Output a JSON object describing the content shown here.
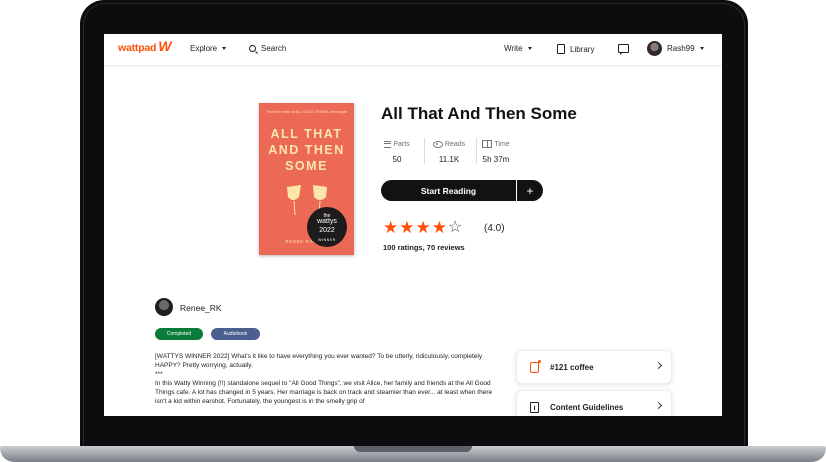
{
  "nav": {
    "logo_text": "wattpad",
    "logo_mark": "W",
    "explore_label": "Explore",
    "search_label": "Search",
    "write_label": "Write",
    "library_label": "Library",
    "username": "Rash99"
  },
  "book": {
    "title": "All That And Then Some",
    "cover": {
      "tagline": "From the writer of ALL GOOD THINGS, the sequel ...",
      "title_lines": [
        "ALL THAT",
        "AND THEN",
        "SOME"
      ],
      "author_line": "RENEE RACHEL",
      "badge": {
        "the": "the",
        "name": "wattys",
        "year": "2022",
        "label": "WINNER"
      },
      "background": "#ec6a55"
    },
    "stats": [
      {
        "label": "Parts",
        "value": "50",
        "icon": "list-icon"
      },
      {
        "label": "Reads",
        "value": "11.1K",
        "icon": "eye-icon"
      },
      {
        "label": "Time",
        "value": "5h 37m",
        "icon": "book-open-icon"
      }
    ],
    "start_reading_label": "Start Reading",
    "add_label": "+",
    "rating": {
      "stars_filled": 4,
      "stars_total": 5,
      "value_text": "(4.0)",
      "summary": "100 ratings, 70 reviews"
    },
    "author": "Renee_RK",
    "tags": [
      {
        "label": "Completed",
        "color": "#0a7c3a"
      },
      {
        "label": "Audiobook",
        "color": "#4a5f8f"
      }
    ],
    "description": [
      "[WATTYS WINNER 2022] What's it like to have everything you ever wanted? To be utterly, ridiculously, completely HAPPY? Pretty worrying, actually.",
      "***",
      "In this Watty Winning (!!) standalone sequel to \"All Good Things\", we visit Alice, her family and friends at the All Good Things cafe. A lot has changed in 5 years. Her marriage is back on track and steamier than ever... at least when there isn't a kid within earshot. Fortunately, the youngest is in the smelly grip of"
    ]
  },
  "side_cards": [
    {
      "label": "#121 coffee",
      "icon": "ranking-icon"
    },
    {
      "label": "Content Guidelines",
      "icon": "guidelines-icon"
    }
  ],
  "colors": {
    "brand": "#ff500a",
    "button": "#121212"
  }
}
